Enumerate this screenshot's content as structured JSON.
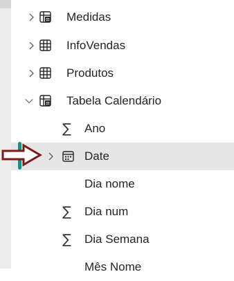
{
  "tree": {
    "items": [
      {
        "label": "Medidas",
        "expander": "chevron-right",
        "icon": "measure-table-icon"
      },
      {
        "label": "InfoVendas",
        "expander": "chevron-right",
        "icon": "table-icon"
      },
      {
        "label": "Produtos",
        "expander": "chevron-right",
        "icon": "table-icon"
      },
      {
        "label": "Tabela Calendário",
        "expander": "chevron-down",
        "icon": "calendar-table-icon"
      },
      {
        "label": "Ano",
        "icon": "sigma-icon"
      },
      {
        "label": "Date",
        "expander": "chevron-right",
        "icon": "date-hierarchy-icon",
        "selected": true
      },
      {
        "label": "Dia nome"
      },
      {
        "label": "Dia num",
        "icon": "sigma-icon"
      },
      {
        "label": "Dia Semana",
        "icon": "sigma-icon"
      },
      {
        "label": "Mês Nome"
      }
    ]
  },
  "colors": {
    "arrow_fill": "#ffffff",
    "arrow_stroke": "#7a1a1a",
    "selection": "#e6e6e6",
    "marker": "#1f8a86"
  }
}
